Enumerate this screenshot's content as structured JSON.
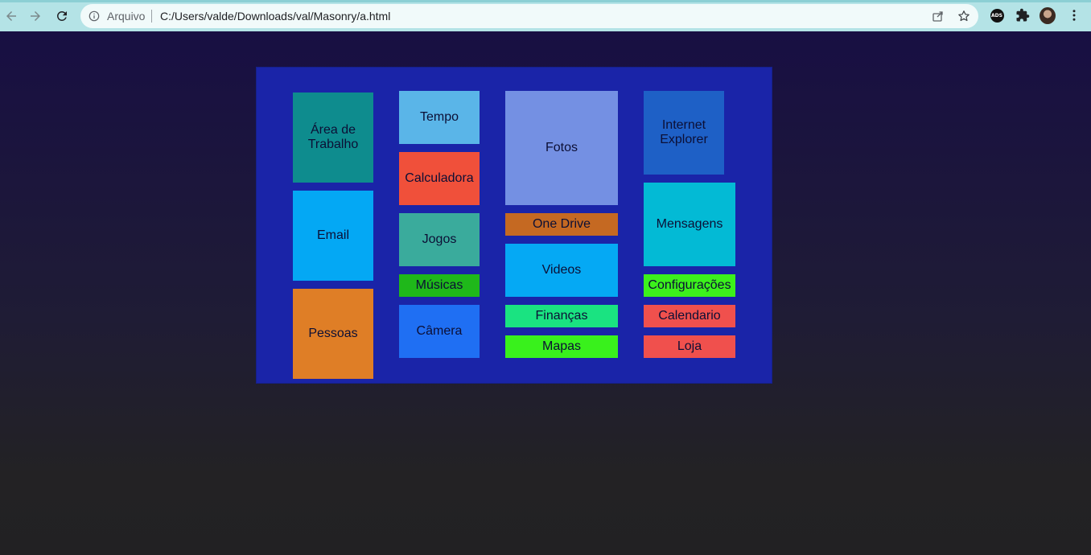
{
  "browser": {
    "scheme_label": "Arquivo",
    "url": "C:/Users/valde/Downloads/val/Masonry/a.html",
    "extension_badge": "ADS",
    "icons": {
      "back": "arrow-left-icon",
      "forward": "arrow-right-icon",
      "reload": "reload-icon",
      "info": "info-icon",
      "share": "share-icon",
      "bookmark": "star-icon",
      "extensions": "puzzle-icon",
      "menu": "kebab-menu-icon"
    }
  },
  "tiles": [
    {
      "id": "area-de-trabalho",
      "label": "Área de Trabalho",
      "color": "#0e8c8e"
    },
    {
      "id": "email",
      "label": "Email",
      "color": "#04a8f4"
    },
    {
      "id": "pessoas",
      "label": "Pessoas",
      "color": "#df7e26"
    },
    {
      "id": "tempo",
      "label": "Tempo",
      "color": "#5ab5e8"
    },
    {
      "id": "calculadora",
      "label": "Calculadora",
      "color": "#f0503a"
    },
    {
      "id": "jogos",
      "label": "Jogos",
      "color": "#3aab9c"
    },
    {
      "id": "musicas",
      "label": "Músicas",
      "color": "#1fb81a"
    },
    {
      "id": "camera",
      "label": "Câmera",
      "color": "#1f6ff3"
    },
    {
      "id": "fotos",
      "label": "Fotos",
      "color": "#7490e3"
    },
    {
      "id": "one-drive",
      "label": "One Drive",
      "color": "#c56922"
    },
    {
      "id": "videos",
      "label": "Videos",
      "color": "#05a9f4"
    },
    {
      "id": "financas",
      "label": "Finanças",
      "color": "#1ae381"
    },
    {
      "id": "mapas",
      "label": "Mapas",
      "color": "#39f11c"
    },
    {
      "id": "internet-explorer",
      "label": "Internet Explorer",
      "color": "#1e60c6"
    },
    {
      "id": "mensagens",
      "label": "Mensagens",
      "color": "#03bad5"
    },
    {
      "id": "configuracoes",
      "label": "Configurações",
      "color": "#3cf11c"
    },
    {
      "id": "calendario",
      "label": "Calendario",
      "color": "#f0504d"
    },
    {
      "id": "loja",
      "label": "Loja",
      "color": "#f0504d"
    }
  ]
}
